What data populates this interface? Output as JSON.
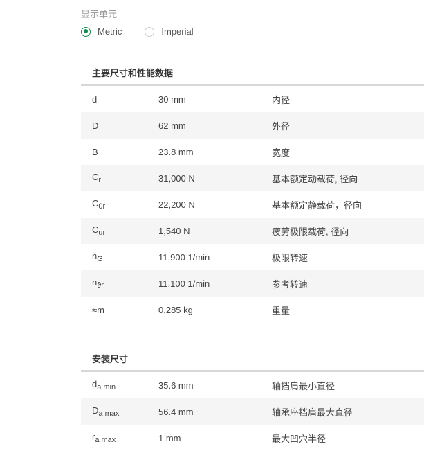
{
  "units": {
    "label": "显示单元",
    "options": [
      {
        "label": "Metric",
        "selected": true
      },
      {
        "label": "Imperial",
        "selected": false
      }
    ]
  },
  "sections": [
    {
      "title": "主要尺寸和性能数据",
      "rows": [
        {
          "sym": "d",
          "sub": "",
          "value": "30 mm",
          "desc": "内径"
        },
        {
          "sym": "D",
          "sub": "",
          "value": "62 mm",
          "desc": "外径"
        },
        {
          "sym": "B",
          "sub": "",
          "value": "23.8 mm",
          "desc": "宽度"
        },
        {
          "sym": "C",
          "sub": "r",
          "value": "31,000 N",
          "desc": "基本额定动载荷, 径向"
        },
        {
          "sym": "C",
          "sub": "0r",
          "value": "22,200 N",
          "desc": "基本额定静载荷，径向"
        },
        {
          "sym": "C",
          "sub": "ur",
          "value": "1,540 N",
          "desc": "疲劳极限载荷, 径向"
        },
        {
          "sym": "n",
          "sub": "G",
          "value": "11,900 1/min",
          "desc": "极限转速"
        },
        {
          "sym": "n",
          "sub": "ϑr",
          "value": "11,100 1/min",
          "desc": "参考转速"
        },
        {
          "sym": "≈m",
          "sub": "",
          "value": "0.285 kg",
          "desc": "重量"
        }
      ]
    },
    {
      "title": "安装尺寸",
      "rows": [
        {
          "sym": "d",
          "sub": "a min",
          "value": "35.6 mm",
          "desc": "轴挡肩最小直径"
        },
        {
          "sym": "D",
          "sub": "a max",
          "value": "56.4 mm",
          "desc": "轴承座挡肩最大直径"
        },
        {
          "sym": "r",
          "sub": "a max",
          "value": "1 mm",
          "desc": "最大凹穴半径"
        }
      ]
    }
  ]
}
